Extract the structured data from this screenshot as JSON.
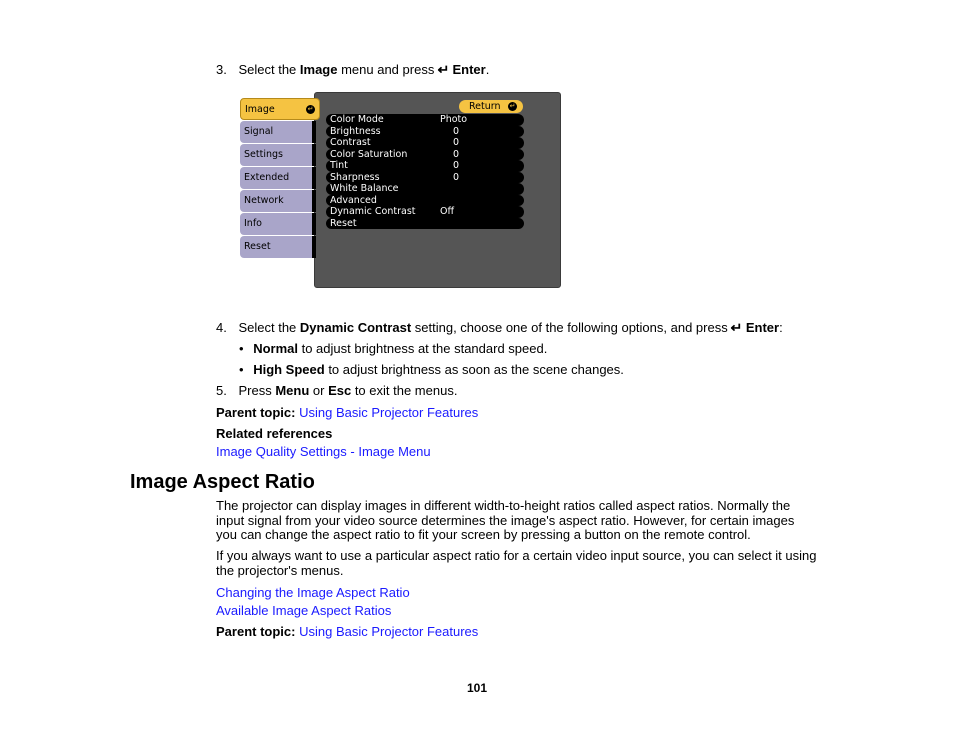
{
  "step3": {
    "num": "3.",
    "pre": "Select the ",
    "bold": "Image",
    "mid": " menu and press ",
    "enter_glyph": "↵",
    "enter": "Enter",
    "post": "."
  },
  "menu": {
    "tabs": [
      {
        "label": "Image",
        "active": true
      },
      {
        "label": "Signal"
      },
      {
        "label": "Settings"
      },
      {
        "label": "Extended"
      },
      {
        "label": "Network"
      },
      {
        "label": "Info"
      },
      {
        "label": "Reset"
      }
    ],
    "enter_symbol": "↵",
    "return_label": "Return",
    "items": [
      {
        "label": "Color Mode",
        "value": "Photo"
      },
      {
        "label": "Brightness",
        "value": "0"
      },
      {
        "label": "Contrast",
        "value": "0"
      },
      {
        "label": "Color Saturation",
        "value": "0"
      },
      {
        "label": "Tint",
        "value": "0"
      },
      {
        "label": "Sharpness",
        "value": "0"
      },
      {
        "label": "White Balance",
        "value": ""
      },
      {
        "label": "Advanced",
        "value": ""
      },
      {
        "label": "Dynamic Contrast",
        "value": "Off"
      },
      {
        "label": "Reset",
        "value": ""
      }
    ],
    "colors": {
      "active_tab": "#f5c342",
      "tab": "#a9a5c9",
      "panel": "#555555"
    }
  },
  "step4": {
    "num": "4.",
    "pre": "Select the ",
    "bold": "Dynamic Contrast",
    "mid": " setting, choose one of the following options, and press ",
    "enter_glyph": "↵",
    "enter": "Enter",
    "post": ":"
  },
  "bullets": [
    {
      "bold": "Normal",
      "text": " to adjust brightness at the standard speed."
    },
    {
      "bold": "High Speed",
      "text": " to adjust brightness as soon as the scene changes."
    }
  ],
  "step5": {
    "num": "5.",
    "pre": "Press ",
    "bold1": "Menu",
    "mid": " or ",
    "bold2": "Esc",
    "post": " to exit the menus."
  },
  "parent_topic_1": {
    "label": "Parent topic:",
    "link": "Using Basic Projector Features"
  },
  "related": {
    "label": "Related references",
    "link": "Image Quality Settings - Image Menu"
  },
  "section": {
    "title": "Image Aspect Ratio",
    "para1_lines": [
      "The projector can display images in different width-to-height ratios called aspect ratios. Normally the",
      "input signal from your video source determines the image's aspect ratio. However, for certain images",
      "you can change the aspect ratio to fit your screen by pressing a button on the remote control."
    ],
    "para2_lines": [
      "If you always want to use a particular aspect ratio for a certain video input source, you can select it using",
      "the projector's menus."
    ],
    "links": [
      "Changing the Image Aspect Ratio",
      "Available Image Aspect Ratios"
    ],
    "parent_topic": {
      "label": "Parent topic:",
      "link": "Using Basic Projector Features"
    }
  },
  "page_number": "101",
  "link_color": "#1a1aff"
}
